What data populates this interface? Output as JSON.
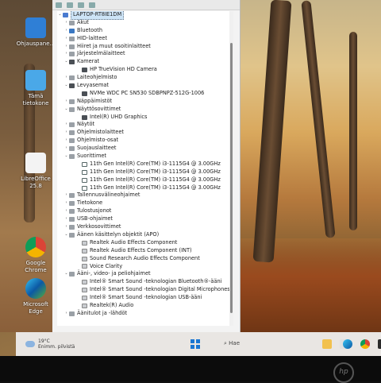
{
  "desktop": {
    "icons": [
      {
        "label": "Ohjauspane...",
        "icon": "control-panel-icon"
      },
      {
        "label": "Tämä tietokone",
        "icon": "this-pc-icon"
      },
      {
        "label": "LibreOffice 25.8",
        "icon": "libreoffice-icon"
      },
      {
        "label": "Google Chrome",
        "icon": "chrome-icon"
      },
      {
        "label": "Microsoft Edge",
        "icon": "edge-icon"
      }
    ]
  },
  "device_manager": {
    "root": "LAPTOP-RT8IE1DM",
    "items": [
      {
        "level": 1,
        "label": "Akut",
        "expanded": false
      },
      {
        "level": 1,
        "label": "Bluetooth",
        "expanded": false
      },
      {
        "level": 1,
        "label": "HID-laitteet",
        "expanded": false
      },
      {
        "level": 1,
        "label": "Hiiret ja muut osoitinlaitteet",
        "expanded": false
      },
      {
        "level": 1,
        "label": "Järjestelmälaitteet",
        "expanded": false
      },
      {
        "level": 1,
        "label": "Kamerat",
        "expanded": true
      },
      {
        "level": 2,
        "label": "HP TrueVision HD Camera"
      },
      {
        "level": 1,
        "label": "Laiteohjelmisto",
        "expanded": false
      },
      {
        "level": 1,
        "label": "Levyasemat",
        "expanded": true
      },
      {
        "level": 2,
        "label": "NVMe WDC PC SN530 SDBPNPZ-512G-1006"
      },
      {
        "level": 1,
        "label": "Näppäimistöt",
        "expanded": false
      },
      {
        "level": 1,
        "label": "Näyttösovittimet",
        "expanded": true
      },
      {
        "level": 2,
        "label": "Intel(R) UHD Graphics"
      },
      {
        "level": 1,
        "label": "Näytöt",
        "expanded": false
      },
      {
        "level": 1,
        "label": "Ohjelmistolaitteet",
        "expanded": false
      },
      {
        "level": 1,
        "label": "Ohjelmisto-osat",
        "expanded": false
      },
      {
        "level": 1,
        "label": "Suojauslaitteet",
        "expanded": false
      },
      {
        "level": 1,
        "label": "Suorittimet",
        "expanded": true
      },
      {
        "level": 2,
        "label": "11th Gen Intel(R) Core(TM) i3-1115G4 @ 3.00GHz"
      },
      {
        "level": 2,
        "label": "11th Gen Intel(R) Core(TM) i3-1115G4 @ 3.00GHz"
      },
      {
        "level": 2,
        "label": "11th Gen Intel(R) Core(TM) i3-1115G4 @ 3.00GHz"
      },
      {
        "level": 2,
        "label": "11th Gen Intel(R) Core(TM) i3-1115G4 @ 3.00GHz"
      },
      {
        "level": 1,
        "label": "Tallennusvälineohjaimet",
        "expanded": false
      },
      {
        "level": 1,
        "label": "Tietokone",
        "expanded": false
      },
      {
        "level": 1,
        "label": "Tulostusjonot",
        "expanded": false
      },
      {
        "level": 1,
        "label": "USB-ohjaimet",
        "expanded": false
      },
      {
        "level": 1,
        "label": "Verkkosovittimet",
        "expanded": false
      },
      {
        "level": 1,
        "label": "Äänen käsittelyn objektit (APO)",
        "expanded": true
      },
      {
        "level": 2,
        "label": "Realtek Audio Effects Component"
      },
      {
        "level": 2,
        "label": "Realtek Audio Effects Component (INT)"
      },
      {
        "level": 2,
        "label": "Sound Research Audio Effects Component"
      },
      {
        "level": 2,
        "label": "Voice Clarity"
      },
      {
        "level": 1,
        "label": "Ääni-, video- ja peliohjaimet",
        "expanded": true
      },
      {
        "level": 2,
        "label": "Intel® Smart Sound -teknologian Bluetooth®-ääni"
      },
      {
        "level": 2,
        "label": "Intel® Smart Sound -teknologian Digital Microphones"
      },
      {
        "level": 2,
        "label": "Intel® Smart Sound -teknologian USB-ääni"
      },
      {
        "level": 2,
        "label": "Realtek(R) Audio"
      },
      {
        "level": 1,
        "label": "Äänitulot ja -lähdöt",
        "expanded": false
      }
    ]
  },
  "taskbar": {
    "temperature": "19°C",
    "weather": "Enimm. pilvistä",
    "search_placeholder": "Hae"
  }
}
